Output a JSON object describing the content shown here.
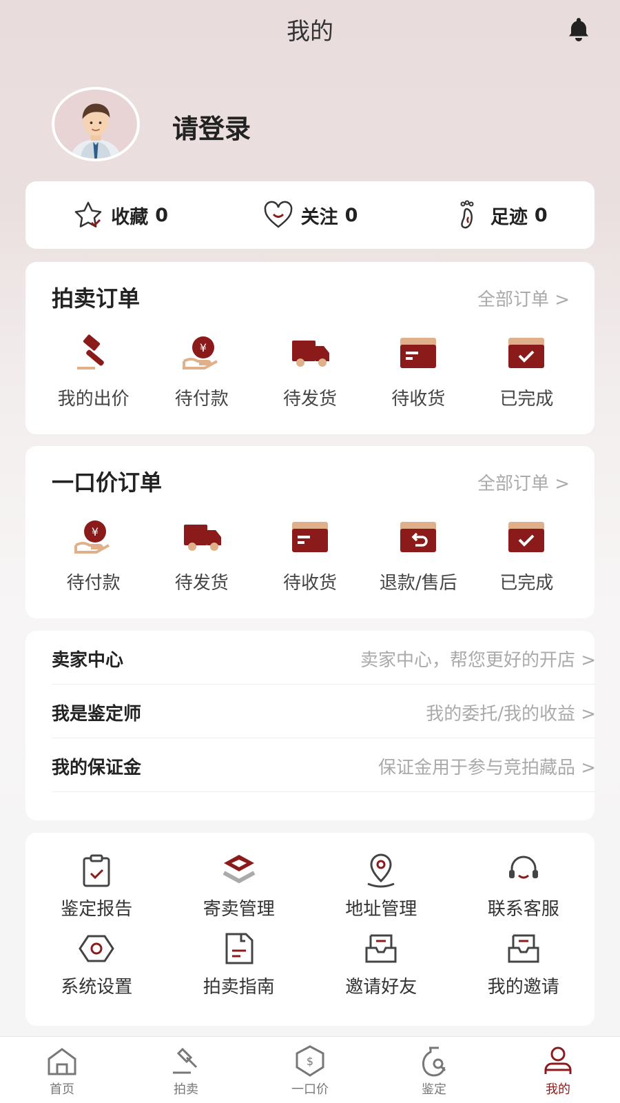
{
  "header": {
    "title": "我的",
    "bell_icon": "bell-icon"
  },
  "profile": {
    "login_text": "请登录",
    "avatar_icon": "user-avatar-icon"
  },
  "stats": [
    {
      "icon": "star-icon",
      "label": "收藏",
      "count": "0"
    },
    {
      "icon": "heart-icon",
      "label": "关注",
      "count": "0"
    },
    {
      "icon": "footprint-icon",
      "label": "足迹",
      "count": "0"
    }
  ],
  "auction_orders": {
    "title": "拍卖订单",
    "all_label": "全部订单 >",
    "items": [
      {
        "icon": "gavel-icon",
        "label": "我的出价"
      },
      {
        "icon": "pay-icon",
        "label": "待付款"
      },
      {
        "icon": "truck-icon",
        "label": "待发货"
      },
      {
        "icon": "box-icon",
        "label": "待收货"
      },
      {
        "icon": "check-box-icon",
        "label": "已完成"
      }
    ]
  },
  "fixed_orders": {
    "title": "一口价订单",
    "all_label": "全部订单 >",
    "items": [
      {
        "icon": "pay-icon",
        "label": "待付款"
      },
      {
        "icon": "truck-icon",
        "label": "待发货"
      },
      {
        "icon": "box-icon",
        "label": "待收货"
      },
      {
        "icon": "refund-icon",
        "label": "退款/售后"
      },
      {
        "icon": "check-box-icon",
        "label": "已完成"
      }
    ]
  },
  "links": [
    {
      "label": "卖家中心",
      "desc": "卖家中心，帮您更好的开店 >"
    },
    {
      "label": "我是鉴定师",
      "desc": "我的委托/我的收益 >"
    },
    {
      "label": "我的保证金",
      "desc": "保证金用于参与竞拍藏品 >"
    }
  ],
  "tools": [
    {
      "icon": "clipboard-check-icon",
      "label": "鉴定报告"
    },
    {
      "icon": "layers-icon",
      "label": "寄卖管理"
    },
    {
      "icon": "location-icon",
      "label": "地址管理"
    },
    {
      "icon": "headset-icon",
      "label": "联系客服"
    },
    {
      "icon": "settings-hex-icon",
      "label": "系统设置"
    },
    {
      "icon": "document-icon",
      "label": "拍卖指南"
    },
    {
      "icon": "inbox-icon",
      "label": "邀请好友"
    },
    {
      "icon": "inbox-icon",
      "label": "我的邀请"
    }
  ],
  "tabbar": [
    {
      "icon": "home-icon",
      "label": "首页",
      "active": false
    },
    {
      "icon": "auction-icon",
      "label": "拍卖",
      "active": false
    },
    {
      "icon": "dollar-shield-icon",
      "label": "一口价",
      "active": false
    },
    {
      "icon": "vase-search-icon",
      "label": "鉴定",
      "active": false
    },
    {
      "icon": "person-icon",
      "label": "我的",
      "active": true
    }
  ],
  "colors": {
    "accent": "#8b1a1a",
    "icon_gray": "#555555"
  }
}
